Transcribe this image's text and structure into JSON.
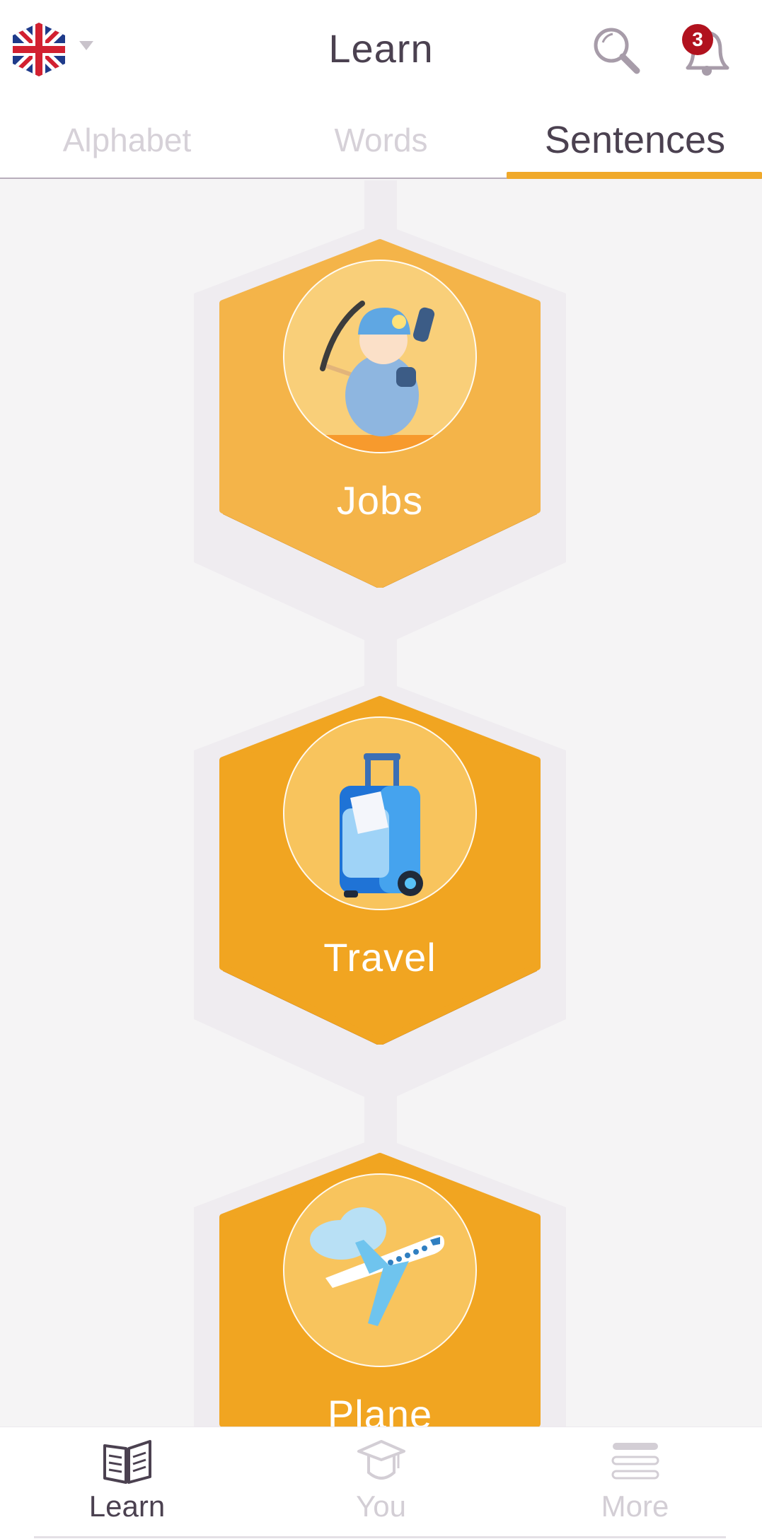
{
  "header": {
    "language_flag": "uk-flag",
    "title": "Learn",
    "notification_count": "3"
  },
  "tabs": [
    {
      "label": "Alphabet",
      "active": false
    },
    {
      "label": "Words",
      "active": false
    },
    {
      "label": "Sentences",
      "active": true
    }
  ],
  "lessons": [
    {
      "label": "Jobs",
      "icon": "miner-icon",
      "hex_color": "#f4b449",
      "circle_color": "#f9cf79"
    },
    {
      "label": "Travel",
      "icon": "suitcase-icon",
      "hex_color": "#f1a521",
      "circle_color": "#f8c45d"
    },
    {
      "label": "Plane",
      "icon": "airplane-icon",
      "hex_color": "#f1a521",
      "circle_color": "#f8c45d"
    }
  ],
  "bottom_nav": [
    {
      "label": "Learn",
      "icon": "book-icon",
      "active": true
    },
    {
      "label": "You",
      "icon": "graduation-cap-icon",
      "active": false
    },
    {
      "label": "More",
      "icon": "menu-icon",
      "active": false
    }
  ]
}
